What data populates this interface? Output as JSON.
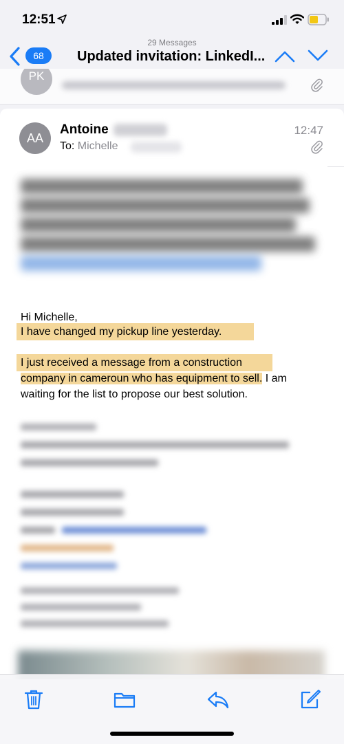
{
  "status_bar": {
    "time": "12:51",
    "icons": [
      "location-arrow-icon",
      "cellular-signal-icon",
      "wifi-icon",
      "battery-icon"
    ],
    "battery_color": "#f2c715"
  },
  "nav": {
    "message_count": "29 Messages",
    "title": "Updated invitation: LinkedI...",
    "back_badge": "68",
    "accent": "#1a7cf6"
  },
  "previous_message": {
    "avatar_initials": "PK"
  },
  "email": {
    "avatar_initials": "AA",
    "sender_first_name": "Antoine",
    "time": "12:47",
    "to_label": "To:",
    "to_name": "Michelle",
    "greeting": "Hi Michelle,",
    "line1": "I have changed my pickup line yesterday.",
    "para2_line1": "I just received a message from a construction",
    "para2_line2_highlighted": "company in cameroun who has equipment to sell.",
    "para2_line2_rest": " I am",
    "para2_line3": "waiting for the list to propose our best solution.",
    "highlight_color": "#f4d79a"
  },
  "toolbar": {
    "icons": [
      "trash-icon",
      "folder-icon",
      "reply-icon",
      "compose-icon"
    ]
  }
}
